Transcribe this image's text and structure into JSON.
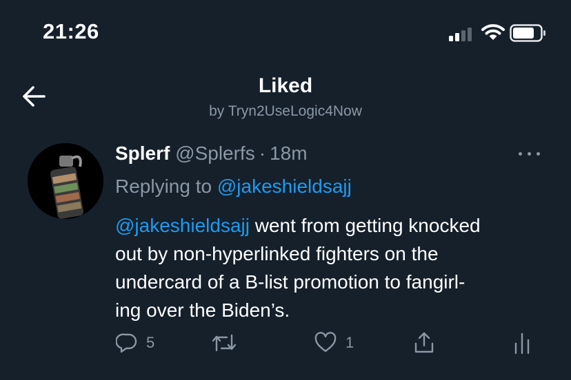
{
  "status": {
    "time": "21:26"
  },
  "header": {
    "title": "Liked",
    "subtitle": "by Tryn2UseLogic4Now"
  },
  "tweet": {
    "display_name": "Splerf",
    "handle": "@Splerfs",
    "separator": "·",
    "time_ago": "18m",
    "replying_prefix": "Replying to",
    "replying_to": "@jakeshieldsajj",
    "body": {
      "mention": "@jakeshieldsajj",
      "line1_rest": " went from getting knocked",
      "line2": "out by non-hyperlinked fighters on the",
      "line3": "undercard of a B-list promotion to fangirl-",
      "line4": "ing over the Biden’s."
    },
    "actions": {
      "reply_count": "5",
      "like_count": "1"
    }
  },
  "icons": [
    "signal-icon",
    "wifi-icon",
    "battery-icon",
    "back-arrow-icon",
    "more-icon",
    "reply-icon",
    "retweet-icon",
    "like-icon",
    "share-icon",
    "analytics-icon"
  ],
  "colors": {
    "background": "#15202b",
    "text": "#ffffff",
    "muted": "#8b98a5",
    "accent": "#1d9bf0"
  }
}
